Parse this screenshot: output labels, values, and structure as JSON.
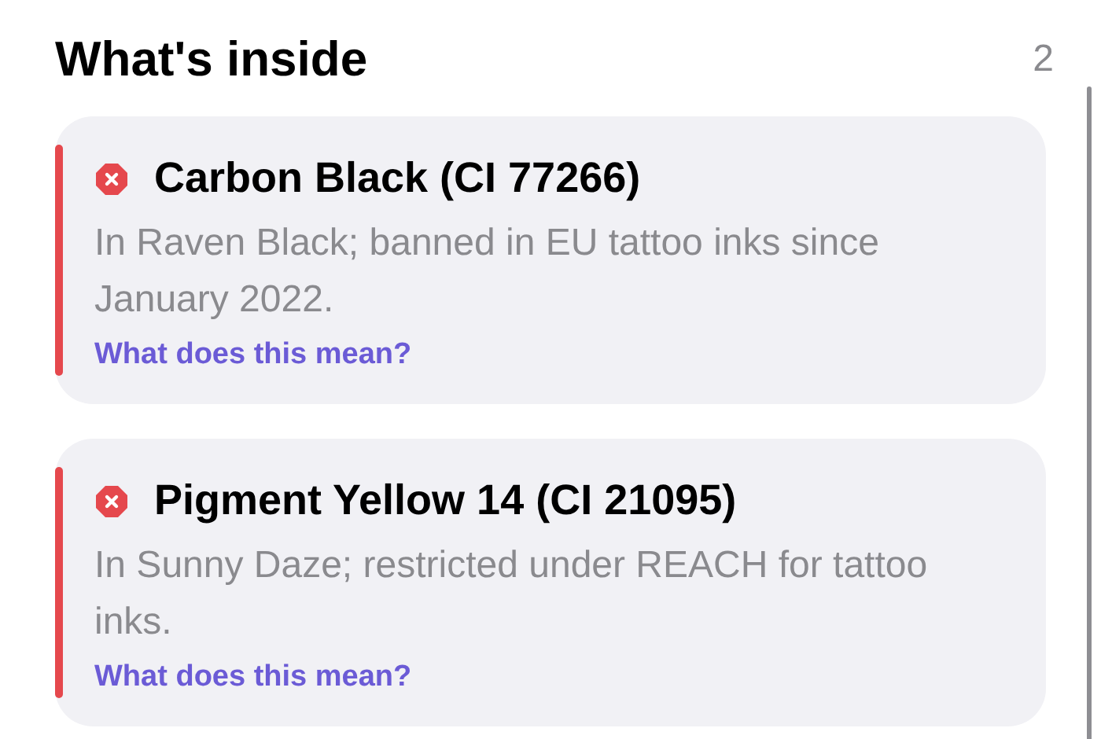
{
  "header": {
    "title": "What's inside",
    "count": "2"
  },
  "items": [
    {
      "kind": "banned",
      "name": "Carbon Black (CI 77266)",
      "description": "In Raven Black; banned in EU tattoo inks since January 2022.",
      "link": "What does this mean?"
    },
    {
      "kind": "banned",
      "name": "Pigment Yellow 14 (CI 21095)",
      "description": "In Sunny Daze; restricted under REACH for tattoo inks.",
      "link": "What does this mean?"
    }
  ]
}
